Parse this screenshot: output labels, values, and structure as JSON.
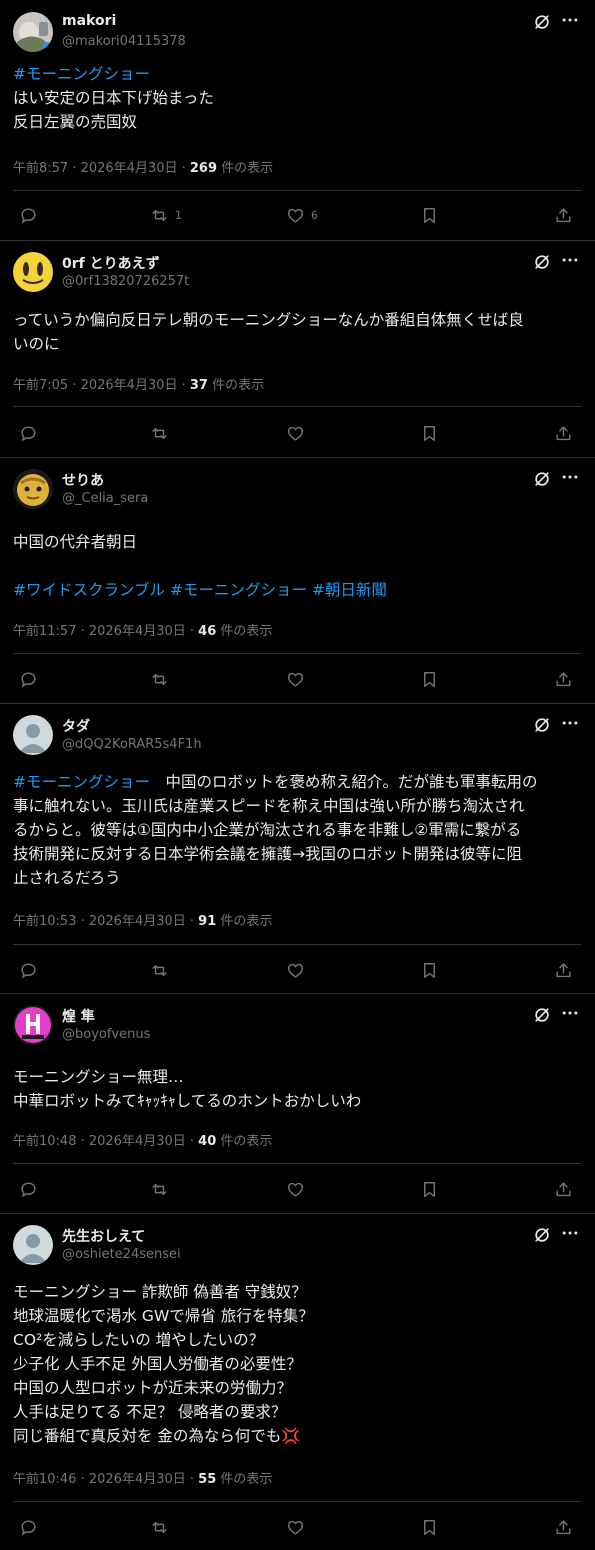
{
  "posts": [
    {
      "name": "makori",
      "handle": "@makori04115378",
      "lines": [
        [
          {
            "t": "#モーニングショー",
            "tag": true
          }
        ],
        [
          {
            "t": "はい安定の日本下げ始まった"
          }
        ],
        [
          {
            "t": "反日左翼の売国奴"
          }
        ]
      ],
      "meta_prefix": "午前8:57 · 2026年4月30日 · ",
      "views": "269",
      "views_suffix": " 件の表示",
      "reposts": "1",
      "likes": "6"
    },
    {
      "name": "0rf とりあえず",
      "handle": "@0rf13820726257t",
      "lines": [
        [
          {
            "t": "っていうか偏向反日テレ朝のモーニングショーなんか番組自体無くせば良"
          }
        ],
        [
          {
            "t": "いのに"
          }
        ]
      ],
      "meta_prefix": "午前7:05 · 2026年4月30日 · ",
      "views": "37",
      "views_suffix": " 件の表示",
      "reposts": "",
      "likes": ""
    },
    {
      "name": "せりあ",
      "handle": "@_Celia_sera",
      "lines": [
        [
          {
            "t": "中国の代弁者朝日"
          }
        ],
        [
          {
            "t": ""
          }
        ],
        [
          {
            "t": "#ワイドスクランブル",
            "tag": true
          },
          {
            "t": " "
          },
          {
            "t": "#モーニングショー",
            "tag": true
          },
          {
            "t": " "
          },
          {
            "t": "#朝日新聞",
            "tag": true
          }
        ]
      ],
      "meta_prefix": "午前11:57 · 2026年4月30日 · ",
      "views": "46",
      "views_suffix": " 件の表示",
      "reposts": "",
      "likes": ""
    },
    {
      "name": "タダ",
      "handle": "@dQQ2KoRAR5s4F1h",
      "lines": [
        [
          {
            "t": "#モーニングショー",
            "tag": true
          },
          {
            "t": "　中国のロボットを褒め称え紹介。だが誰も軍事転用の"
          }
        ],
        [
          {
            "t": "事に触れない。玉川氏は産業スピードを称え中国は強い所が勝ち淘汰され"
          }
        ],
        [
          {
            "t": "るからと。彼等は①国内中小企業が淘汰される事を非難し②軍需に繋がる"
          }
        ],
        [
          {
            "t": "技術開発に反対する日本学術会議を擁護→我国のロボット開発は彼等に阻"
          }
        ],
        [
          {
            "t": "止されるだろう"
          }
        ]
      ],
      "meta_prefix": "午前10:53 · 2026年4月30日 · ",
      "views": "91",
      "views_suffix": " 件の表示",
      "reposts": "",
      "likes": ""
    },
    {
      "name": "煌 隼",
      "handle": "@boyofvenus",
      "lines": [
        [
          {
            "t": "モーニングショー無理…"
          }
        ],
        [
          {
            "t": "中華ロボットみてｷｬｯｷｬしてるのホントおかしいわ"
          }
        ]
      ],
      "meta_prefix": "午前10:48 · 2026年4月30日 · ",
      "views": "40",
      "views_suffix": " 件の表示",
      "reposts": "",
      "likes": ""
    },
    {
      "name": "先生おしえて",
      "handle": "@oshiete24sensei",
      "lines": [
        [
          {
            "t": "モーニングショー 詐欺師 偽善者 守銭奴？"
          }
        ],
        [
          {
            "t": "地球温暖化で渇水 GWで帰省 旅行を特集？"
          }
        ],
        [
          {
            "t": "CO²を減らしたいの 増やしたいの？"
          }
        ],
        [
          {
            "t": "少子化 人手不足 外国人労働者の必要性？"
          }
        ],
        [
          {
            "t": "中国の人型ロボットが近未来の労働力？"
          }
        ],
        [
          {
            "t": "人手は足りてる 不足？ 侵略者の要求？"
          }
        ],
        [
          {
            "t": "同じ番組で真反対を 金の為なら何でも💢"
          }
        ]
      ],
      "meta_prefix": "午前10:46 · 2026年4月30日 · ",
      "views": "55",
      "views_suffix": " 件の表示",
      "reposts": "",
      "likes": ""
    }
  ]
}
